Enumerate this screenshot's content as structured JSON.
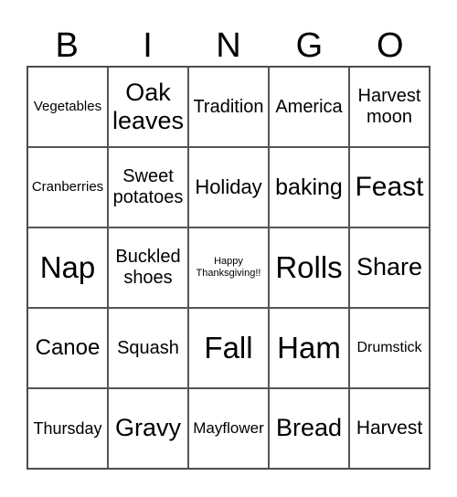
{
  "header": [
    "B",
    "I",
    "N",
    "G",
    "O"
  ],
  "cells": [
    "Vegetables",
    "Oak leaves",
    "Tradition",
    "America",
    "Harvest moon",
    "Cranberries",
    "Sweet potatoes",
    "Holiday",
    "baking",
    "Feast",
    "Nap",
    "Buckled shoes",
    "Happy Thanksgiving!!",
    "Rolls",
    "Share",
    "Canoe",
    "Squash",
    "Fall",
    "Ham",
    "Drumstick",
    "Thursday",
    "Gravy",
    "Mayflower",
    "Bread",
    "Harvest"
  ]
}
